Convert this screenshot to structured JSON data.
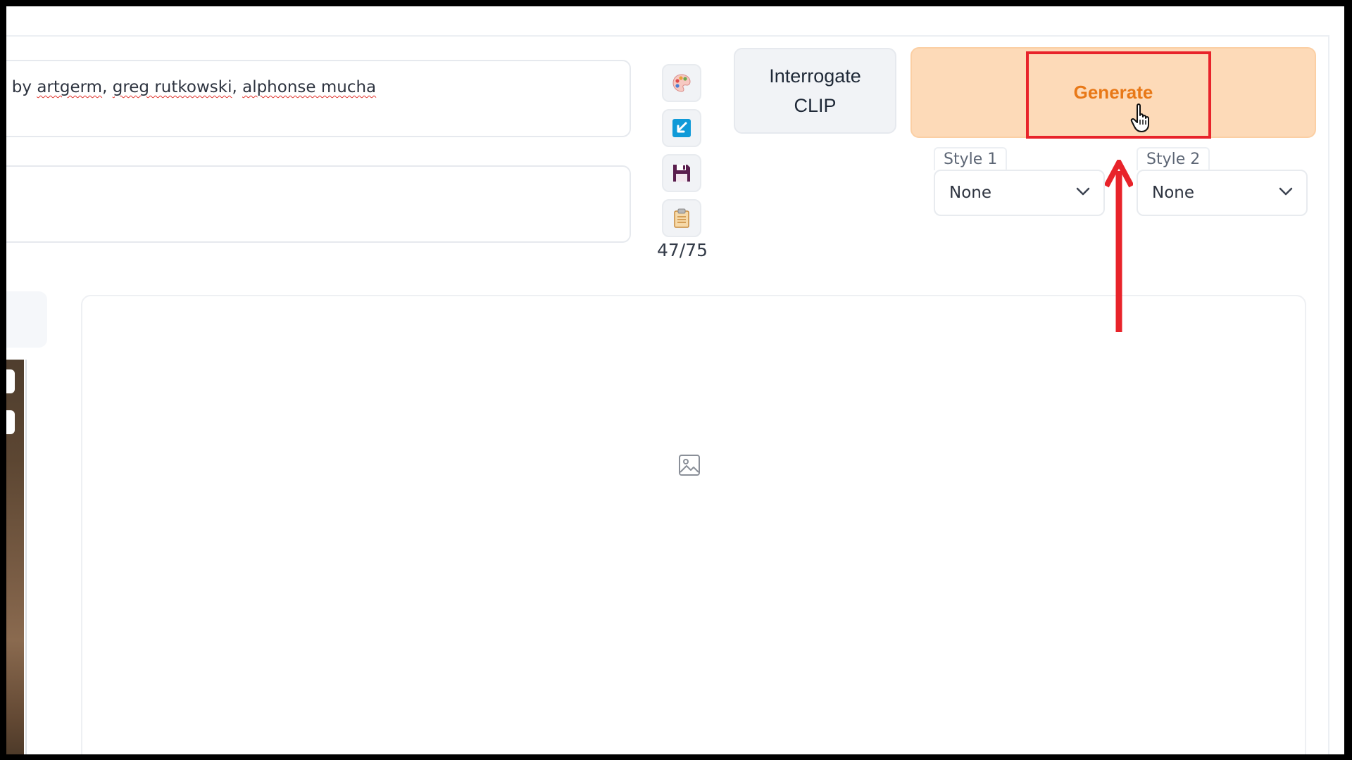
{
  "prompt": {
    "positive_text_prefix": "rt by ",
    "positive_names": [
      "artgerm",
      "greg rutkowski",
      "alphonse mucha"
    ],
    "negative_text": ""
  },
  "toolbar": {
    "tools": [
      {
        "icon": "palette-icon",
        "label": ""
      },
      {
        "icon": "apply-style-arrow-icon",
        "label": ""
      },
      {
        "icon": "save-floppy-icon",
        "label": ""
      },
      {
        "icon": "clipboard-icon",
        "label": ""
      }
    ],
    "token_count": "47/75"
  },
  "buttons": {
    "interrogate_label": "Interrogate\nCLIP",
    "generate_label": "Generate"
  },
  "styles": {
    "style1": {
      "label": "Style 1",
      "value": "None"
    },
    "style2": {
      "label": "Style 2",
      "value": "None"
    }
  },
  "output": {
    "placeholder_icon": "image-placeholder-icon"
  },
  "annotation": {
    "color": "#e8232a",
    "highlight_target": "Generate"
  },
  "colors": {
    "generate_bg": "#fddab8",
    "generate_text": "#e87817",
    "accent_blue": "#0f9ad8"
  }
}
